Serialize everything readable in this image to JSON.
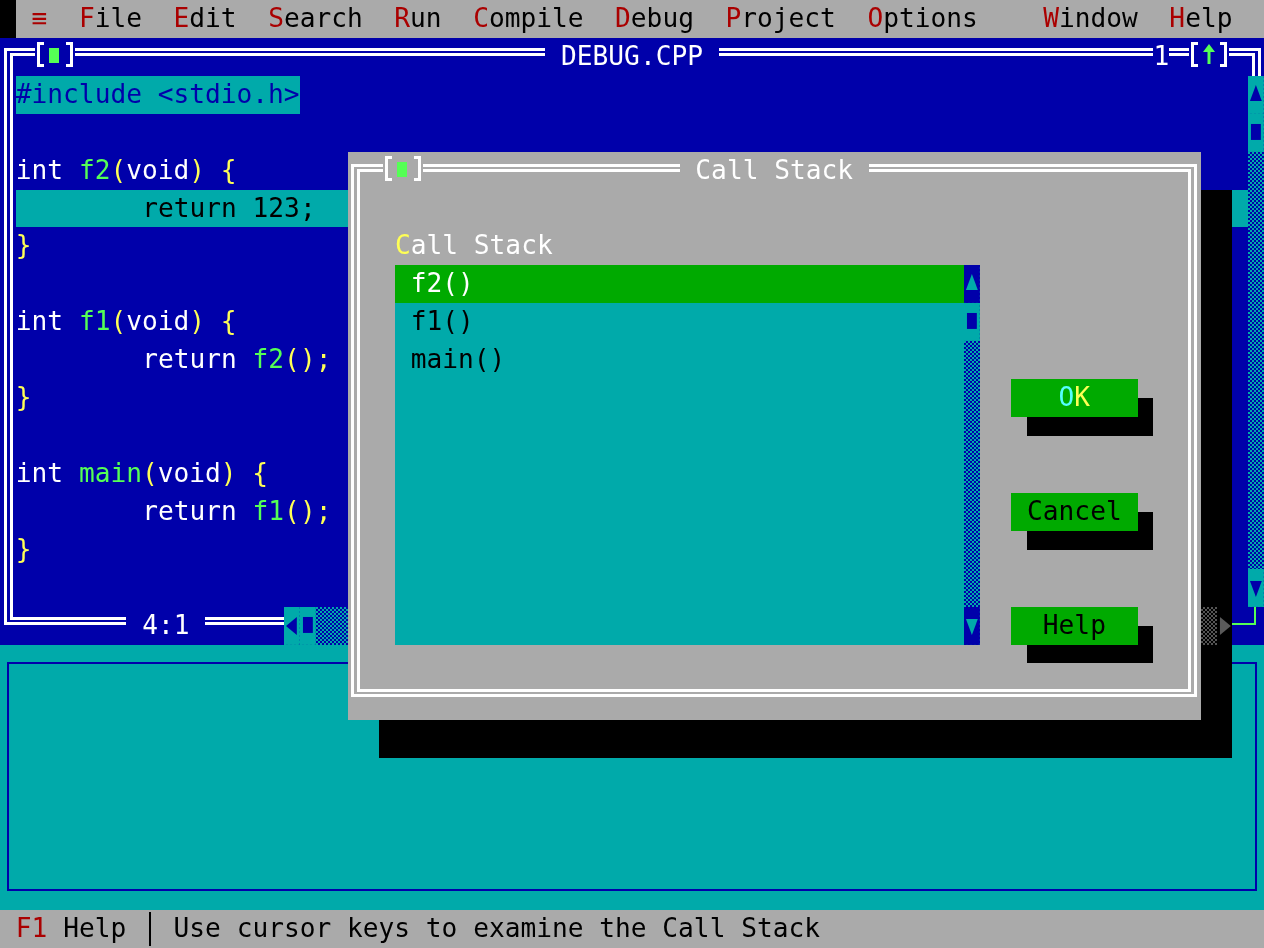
{
  "menu_bar": {
    "items": [
      "≡",
      "File",
      "Edit",
      "Search",
      "Run",
      "Compile",
      "Debug",
      "Project",
      "Options"
    ],
    "end_items": [
      "Window",
      "Help"
    ]
  },
  "editor_window": {
    "title": "DEBUG.CPP",
    "number": "1",
    "blocks": [
      {
        "lines": [
          {
            "tokens": [
              {
                "kind": "preprocessor",
                "text": "#include <stdio.h>"
              }
            ],
            "selected": true,
            "execution_point": false
          }
        ]
      },
      {
        "lines": [
          {
            "tokens": [
              {
                "kind": "keyword",
                "text": "int "
              },
              {
                "kind": "function",
                "text": "f2"
              },
              {
                "kind": "punct",
                "text": "("
              },
              {
                "kind": "keyword",
                "text": "void"
              },
              {
                "kind": "punct",
                "text": ") {"
              }
            ],
            "selected": false,
            "execution_point": false,
            "children": [
              {
                "tokens": [
                  {
                    "kind": "keyword",
                    "text": "return "
                  },
                  {
                    "kind": "number",
                    "text": "123"
                  },
                  {
                    "kind": "punct",
                    "text": ";"
                  }
                ],
                "selected": false,
                "execution_point": true
              }
            ]
          },
          {
            "tokens": [
              {
                "kind": "punct",
                "text": "}"
              }
            ],
            "selected": false,
            "execution_point": false
          }
        ]
      },
      {
        "lines": [
          {
            "tokens": [
              {
                "kind": "keyword",
                "text": "int "
              },
              {
                "kind": "function",
                "text": "f1"
              },
              {
                "kind": "punct",
                "text": "("
              },
              {
                "kind": "keyword",
                "text": "void"
              },
              {
                "kind": "punct",
                "text": ") {"
              }
            ],
            "selected": false,
            "execution_point": false,
            "children": [
              {
                "tokens": [
                  {
                    "kind": "keyword",
                    "text": "return "
                  },
                  {
                    "kind": "function",
                    "text": "f2"
                  },
                  {
                    "kind": "punct",
                    "text": "();"
                  }
                ],
                "selected": false,
                "execution_point": false
              }
            ]
          },
          {
            "tokens": [
              {
                "kind": "punct",
                "text": "}"
              }
            ],
            "selected": false,
            "execution_point": false
          }
        ]
      },
      {
        "lines": [
          {
            "tokens": [
              {
                "kind": "keyword",
                "text": "int "
              },
              {
                "kind": "function",
                "text": "main"
              },
              {
                "kind": "punct",
                "text": "("
              },
              {
                "kind": "keyword",
                "text": "void"
              },
              {
                "kind": "punct",
                "text": ") {"
              }
            ],
            "selected": false,
            "execution_point": false,
            "children": [
              {
                "tokens": [
                  {
                    "kind": "keyword",
                    "text": "return "
                  },
                  {
                    "kind": "function",
                    "text": "f1"
                  },
                  {
                    "kind": "punct",
                    "text": "();"
                  }
                ],
                "selected": false,
                "execution_point": false
              }
            ]
          },
          {
            "tokens": [
              {
                "kind": "punct",
                "text": "}"
              }
            ],
            "selected": false,
            "execution_point": false
          }
        ]
      }
    ],
    "cursor_position": "4:1"
  },
  "call_stack_dialog": {
    "title": "Call Stack",
    "list_label": "Call Stack",
    "items": [
      {
        "label": "f2()",
        "selected": true
      },
      {
        "label": "f1()",
        "selected": false
      },
      {
        "label": "main()",
        "selected": false
      }
    ],
    "buttons": [
      {
        "label": "OK",
        "default": true
      },
      {
        "label": "Cancel",
        "default": false
      },
      {
        "label": "Help",
        "default": false
      }
    ]
  },
  "status_bar": {
    "items": [
      {
        "key": "F1",
        "label": "Help"
      }
    ],
    "hint": "Use cursor keys to examine the Call Stack"
  }
}
